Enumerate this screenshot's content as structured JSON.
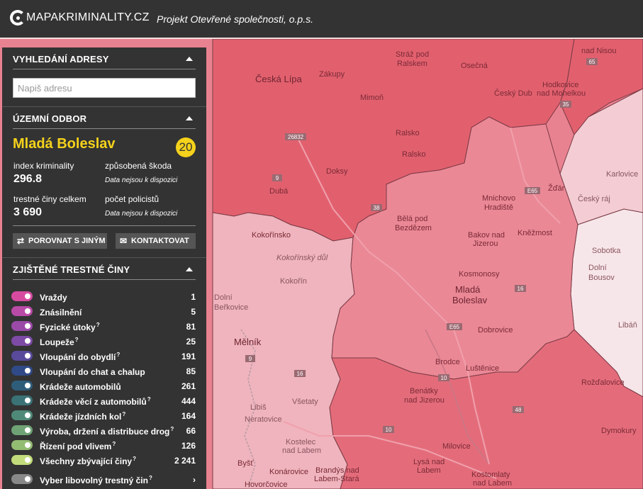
{
  "header": {
    "logo_text": "MAPAKRIMINALITY.CZ",
    "tagline": "Projekt Otevřené společnosti, o.p.s."
  },
  "search": {
    "title": "VYHLEDÁNÍ ADRESY",
    "placeholder": "Napiš adresu"
  },
  "district": {
    "title": "ÚZEMNÍ ODBOR",
    "name": "Mladá Boleslav",
    "rank": "20",
    "index_label": "index kriminality",
    "index_value": "296.8",
    "damage_label": "způsobená škoda",
    "damage_value": "Data nejsou k dispozici",
    "total_label": "trestné činy celkem",
    "total_value": "3 690",
    "police_label": "počet policistů",
    "police_value": "Data nejsou k dispozici",
    "compare_label": "POROVNAT S JINÝM",
    "contact_label": "KONTAKTOVAT"
  },
  "crimes": {
    "title": "ZJIŠTĚNÉ TRESTNÉ ČINY",
    "items": [
      {
        "label": "Vraždy",
        "count": "1",
        "color": "#d64aa0",
        "q": ""
      },
      {
        "label": "Znásilnění",
        "count": "5",
        "color": "#b94aa6",
        "q": ""
      },
      {
        "label": "Fyzické útoky",
        "count": "81",
        "color": "#9b4aa8",
        "q": "?"
      },
      {
        "label": "Loupeže",
        "count": "25",
        "color": "#7d4aa6",
        "q": "?"
      },
      {
        "label": "Vloupání do obydlí",
        "count": "191",
        "color": "#5a4a9c",
        "q": "?"
      },
      {
        "label": "Vloupání do chat a chalup",
        "count": "85",
        "color": "#2f4a86",
        "q": ""
      },
      {
        "label": "Krádeže automobilů",
        "count": "261",
        "color": "#2e5d7a",
        "q": ""
      },
      {
        "label": "Krádeže věcí z automobilů",
        "count": "444",
        "color": "#3a7276",
        "q": "?"
      },
      {
        "label": "Krádeže jízdních kol",
        "count": "164",
        "color": "#4f8a78",
        "q": "?"
      },
      {
        "label": "Výroba, držení a distribuce drog",
        "count": "66",
        "color": "#6fa376",
        "q": "?"
      },
      {
        "label": "Řízení pod vlivem",
        "count": "126",
        "color": "#93bd72",
        "q": "?"
      },
      {
        "label": "Všechny zbývající činy",
        "count": "2 241",
        "color": "#c2dc7c",
        "q": "?"
      },
      {
        "label": "Vyber libovolný trestný čin",
        "count": "",
        "color": "#888888",
        "q": "?"
      }
    ]
  },
  "map": {
    "towns": [
      "Stráž pod Ralskem",
      "Osečná",
      "Hodkovice nad Mohelkou",
      "Česká Lípa",
      "Zákupy",
      "Mimoň",
      "Český Dub",
      "Ralsko",
      "Doksy",
      "Dubá",
      "Kokořínsko",
      "Kokořínský důl",
      "Kokořín",
      "Bělá pod Bezdězem",
      "Mnichovo Hradiště",
      "Žďár",
      "Český ráj",
      "Karlovice",
      "Bakov nad Jizerou",
      "Kněžmost",
      "Sobotka",
      "Dolní Bousov",
      "Kosmonosy",
      "Mladá Boleslav",
      "Dolní Beřkovice",
      "Mělník",
      "Dobrovice",
      "Libáň",
      "Brodce",
      "Luštěnice",
      "Všetaty",
      "Libiš",
      "Neratovice",
      "Benátky nad Jizerou",
      "Rožďalovice",
      "Kostelec nad Labem",
      "Milovice",
      "Dymokury",
      "Byšť",
      "Brandýs nad Labem-Stará Boleslav",
      "Lysá nad Labem",
      "Kostomlaty nad Labem",
      "Hovorčovice",
      "Konárovice"
    ],
    "roads": [
      "26832",
      "9",
      "38",
      "E65",
      "35",
      "16",
      "E65",
      "9",
      "16",
      "10",
      "48",
      "38",
      "65",
      "10"
    ],
    "colors": {
      "high": "#e2606e",
      "mid": "#e98290",
      "low": "#efb4bd",
      "lowest": "#f6dde1",
      "border": "#7a3a45"
    }
  }
}
